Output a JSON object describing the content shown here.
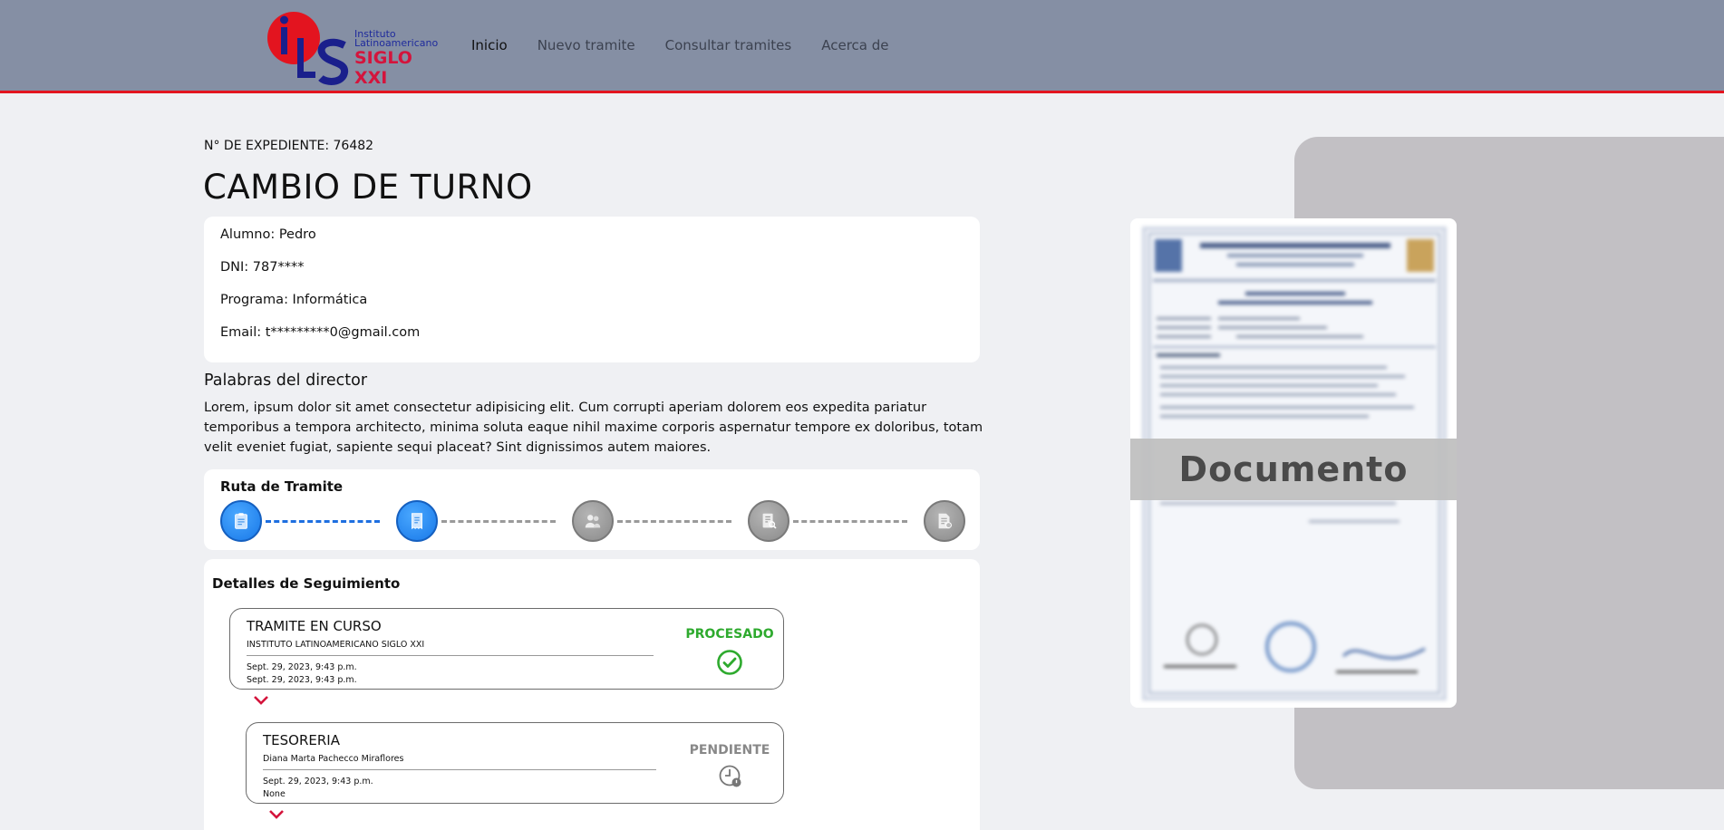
{
  "header": {
    "logo": {
      "line1": "Instituto",
      "line2": "Latinoamericano",
      "line3": "SIGLO XXI"
    },
    "nav": [
      "Inicio",
      "Nuevo tramite",
      "Consultar tramites",
      "Acerca de"
    ],
    "active_nav": "Inicio"
  },
  "colors": {
    "header_bg": "#858fa4",
    "header_border": "#e3141f",
    "step_done": "#1878e8",
    "step_pending": "#8a8a8a",
    "status_ok": "#2eaa2e",
    "status_wait": "#888888",
    "chevron": "#d4143c"
  },
  "expediente": "N° DE EXPEDIENTE: 76482",
  "tramite_title": "CAMBIO DE TURNO",
  "student": {
    "alumno": "Alumno: Pedro",
    "dni": "DNI: 787****",
    "programa": "Programa: Informática",
    "email": "Email: t*********0@gmail.com"
  },
  "director": {
    "title": "Palabras del director",
    "text": "Lorem, ipsum dolor sit amet consectetur adipisicing elit. Cum corrupti aperiam dolorem eos expedita pariatur temporibus a tempora architecto, minima soluta eaque nihil maxime corporis aspernatur tempore ex doloribus, totam velit eveniet fugiat, sapiente sequi placeat? Sint dignissimos autem maiores."
  },
  "ruta": {
    "title": "Ruta de Tramite",
    "steps": [
      {
        "icon": "clipboard-icon",
        "status": "done"
      },
      {
        "icon": "receipt-icon",
        "status": "done"
      },
      {
        "icon": "users-icon",
        "status": "pending"
      },
      {
        "icon": "document-search-icon",
        "status": "pending"
      },
      {
        "icon": "document-edit-icon",
        "status": "pending"
      }
    ]
  },
  "seguimiento": {
    "title": "Detalles de Seguimiento",
    "items": [
      {
        "title": "TRAMITE EN CURSO",
        "subtitle": "INSTITUTO LATINOAMERICANO SIGLO XXI",
        "date1": "Sept. 29, 2023, 9:43 p.m.",
        "date2": "Sept. 29, 2023, 9:43 p.m.",
        "status": "PROCESADO",
        "status_icon": "check-circle-icon"
      },
      {
        "title": "TESORERIA",
        "subtitle": "Diana Marta Pachecco Miraflores",
        "date1": "Sept. 29, 2023, 9:43 p.m.",
        "date2": "None",
        "status": "PENDIENTE",
        "status_icon": "clock-icon"
      }
    ]
  },
  "document": {
    "label": "Documento"
  }
}
